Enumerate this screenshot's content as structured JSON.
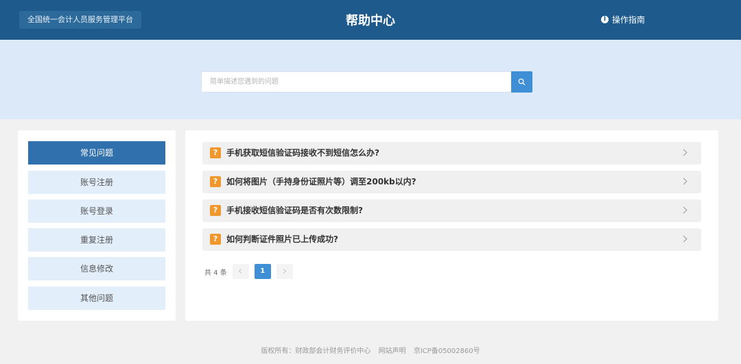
{
  "header": {
    "platform": "全国统一会计人员服务管理平台",
    "title": "帮助中心",
    "guide": "操作指南"
  },
  "search": {
    "placeholder": "简单描述您遇到的问题"
  },
  "sidebar": {
    "items": [
      {
        "label": "常见问题",
        "active": true
      },
      {
        "label": "账号注册"
      },
      {
        "label": "账号登录"
      },
      {
        "label": "重复注册"
      },
      {
        "label": "信息修改"
      },
      {
        "label": "其他问题"
      }
    ]
  },
  "faq": {
    "badge": "?",
    "items": [
      {
        "text": "手机获取短信验证码接收不到短信怎么办?"
      },
      {
        "text": "如何将图片（手持身份证照片等）调至200kb以内?"
      },
      {
        "text": "手机接收短信验证码是否有次数限制?"
      },
      {
        "text": "如何判断证件照片已上传成功?"
      }
    ]
  },
  "pagination": {
    "total": "共 4 条",
    "current": "1"
  },
  "footer": {
    "copyright": "版权所有：财政部会计财务评价中心",
    "statement": "网站声明",
    "icp": "京ICP备05002860号"
  },
  "colors": {
    "header_bg": "#1e5a8c",
    "hero_bg": "#dbe9f9",
    "accent": "#3f8fd6",
    "active_nav": "#2f70ad",
    "question_badge": "#f0972d"
  }
}
